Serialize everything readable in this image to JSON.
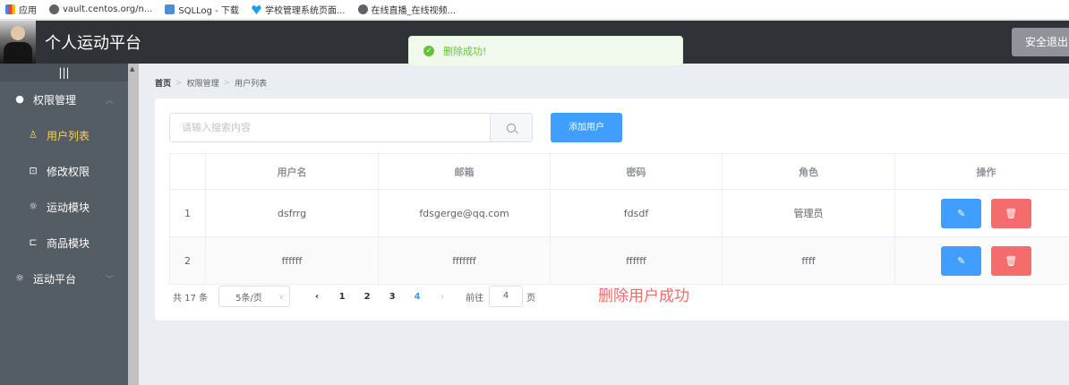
{
  "bookmarks": [
    {
      "label": "应用",
      "icon": "apps-icon"
    },
    {
      "label": "vault.centos.org/n...",
      "icon": "globe-icon"
    },
    {
      "label": "SQLLog - 下载",
      "icon": "sqllog-icon"
    },
    {
      "label": "学校管理系统页面...",
      "icon": "heart-icon"
    },
    {
      "label": "在线直播_在线视频...",
      "icon": "globe-icon"
    }
  ],
  "header": {
    "title": "个人运动平台",
    "logout_label": "安全退出"
  },
  "toast": {
    "message": "删除成功!",
    "color": "#67c23a"
  },
  "sidebar": {
    "collapse_label": "|||",
    "items": [
      {
        "label": "权限管理",
        "icon": "user-icon"
      },
      {
        "label": "用户列表",
        "icon": "person-icon"
      },
      {
        "label": "修改权限",
        "icon": "lock-icon"
      },
      {
        "label": "运动模块",
        "icon": "sun-icon"
      },
      {
        "label": "商品模块",
        "icon": "bag-icon"
      },
      {
        "label": "运动平台",
        "icon": "sun-icon"
      }
    ],
    "active_color": "#ffd04b",
    "background": "#545c64"
  },
  "breadcrumb": [
    "首页",
    "权限管理",
    "用户列表"
  ],
  "search": {
    "placeholder": "请输入搜索内容",
    "value": ""
  },
  "add_button_label": "添加用户",
  "table": {
    "columns": [
      "",
      "用户名",
      "邮箱",
      "密码",
      "角色",
      "操作"
    ],
    "rows": [
      {
        "index": "1",
        "username": "dsfrrg",
        "email": "fdsgerge@qq.com",
        "password": "fdsdf",
        "role": "管理员"
      },
      {
        "index": "2",
        "username": "ffffff",
        "email": "fffffff",
        "password": "ffffff",
        "role": "ffff"
      }
    ]
  },
  "pagination": {
    "total": "共 17 条",
    "page_size": "5条/页",
    "pages": [
      "1",
      "2",
      "3",
      "4"
    ],
    "current": "4",
    "goto_label": "前往",
    "goto_value": "4",
    "page_unit": "页"
  },
  "status_message": "删除用户成功",
  "colors": {
    "primary": "#409eff",
    "danger": "#f56c6c",
    "header": "#2f3236"
  }
}
